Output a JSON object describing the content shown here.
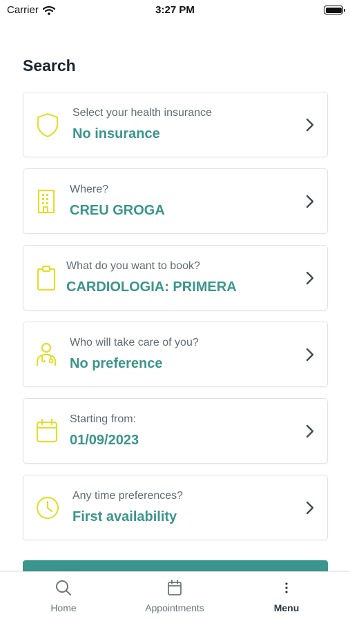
{
  "status_bar": {
    "carrier": "Carrier",
    "time": "3:27 PM"
  },
  "title": "Search",
  "cards": [
    {
      "label": "Select your health insurance",
      "value": "No insurance",
      "icon": "shield-icon"
    },
    {
      "label": "Where?",
      "value": "CREU GROGA",
      "icon": "building-icon"
    },
    {
      "label": "What do you want to book?",
      "value": "CARDIOLOGIA: PRIMERA",
      "icon": "clipboard-icon"
    },
    {
      "label": "Who will take care of you?",
      "value": "No preference",
      "icon": "doctor-icon"
    },
    {
      "label": "Starting from:",
      "value": "01/09/2023",
      "icon": "calendar-icon"
    },
    {
      "label": "Any time preferences?",
      "value": "First availability",
      "icon": "clock-icon"
    }
  ],
  "tabs": [
    {
      "label": "Home",
      "icon": "search-icon"
    },
    {
      "label": "Appointments",
      "icon": "calendar-icon"
    },
    {
      "label": "Menu",
      "icon": "more-icon",
      "active": true
    }
  ],
  "colors": {
    "accent": "#3a958c",
    "icon_yellow": "#e3de2b",
    "label_gray": "#5f6b73"
  }
}
